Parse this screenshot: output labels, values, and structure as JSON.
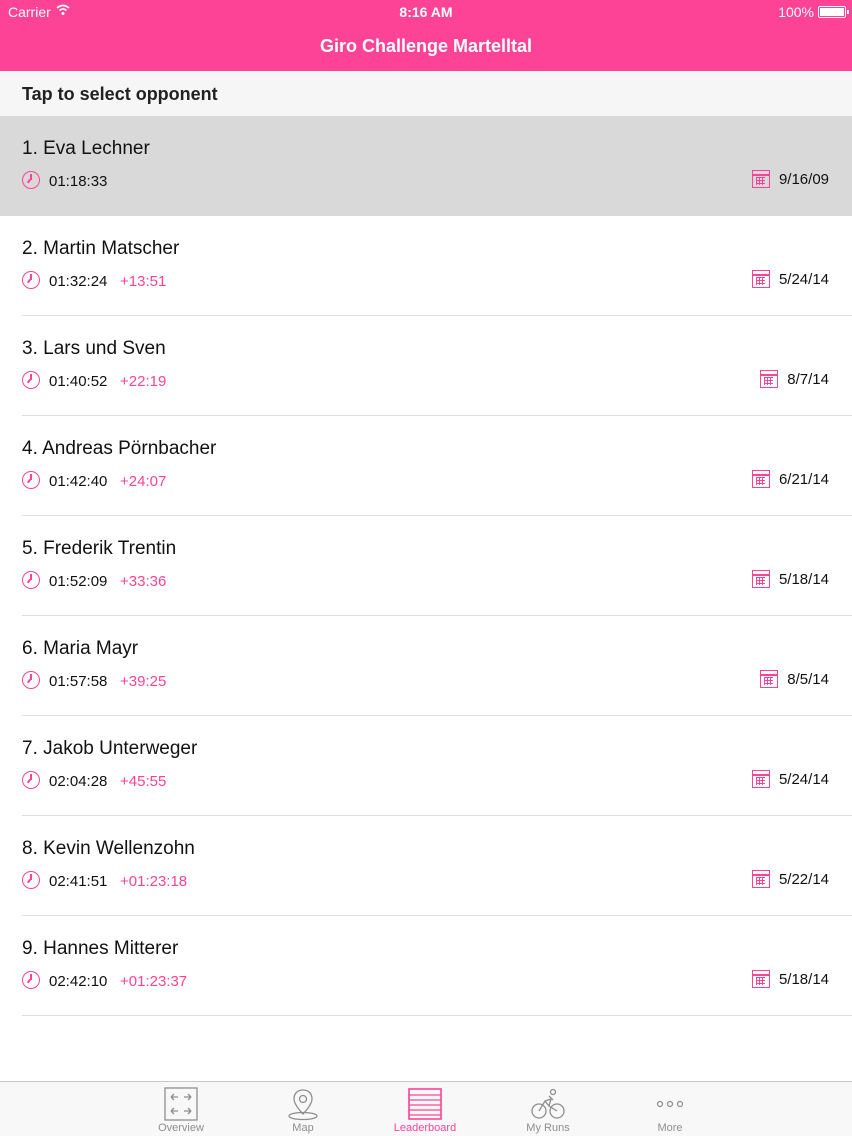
{
  "status_bar": {
    "carrier": "Carrier",
    "time": "8:16 AM",
    "battery": "100%"
  },
  "header": {
    "title": "Giro Challenge Martelltal"
  },
  "section": {
    "title": "Tap to select opponent"
  },
  "rows": [
    {
      "name": "1.  Eva Lechner",
      "time": "01:18:33",
      "delta": "",
      "date": "9/16/09",
      "selected": true
    },
    {
      "name": "2.  Martin Matscher",
      "time": "01:32:24",
      "delta": "+13:51",
      "date": "5/24/14"
    },
    {
      "name": "3.  Lars und Sven",
      "time": "01:40:52",
      "delta": "+22:19",
      "date": "8/7/14"
    },
    {
      "name": "4.  Andreas Pörnbacher",
      "time": "01:42:40",
      "delta": "+24:07",
      "date": "6/21/14"
    },
    {
      "name": "5.  Frederik Trentin",
      "time": "01:52:09",
      "delta": "+33:36",
      "date": "5/18/14"
    },
    {
      "name": "6.  Maria Mayr",
      "time": "01:57:58",
      "delta": "+39:25",
      "date": "8/5/14"
    },
    {
      "name": "7.  Jakob Unterweger",
      "time": "02:04:28",
      "delta": "+45:55",
      "date": "5/24/14"
    },
    {
      "name": "8.  Kevin Wellenzohn",
      "time": "02:41:51",
      "delta": "+01:23:18",
      "date": "5/22/14"
    },
    {
      "name": "9.  Hannes Mitterer",
      "time": "02:42:10",
      "delta": "+01:23:37",
      "date": "5/18/14"
    }
  ],
  "tabs": [
    {
      "label": "Overview",
      "icon": "overview-icon",
      "active": false
    },
    {
      "label": "Map",
      "icon": "map-pin-icon",
      "active": false
    },
    {
      "label": "Leaderboard",
      "icon": "leaderboard-icon",
      "active": true
    },
    {
      "label": "My Runs",
      "icon": "bicycle-icon",
      "active": false
    },
    {
      "label": "More",
      "icon": "more-icon",
      "active": false
    }
  ],
  "colors": {
    "accent": "#fd4395",
    "selected_row": "#d9d9d9",
    "tab_inactive": "#8e8e8e"
  }
}
